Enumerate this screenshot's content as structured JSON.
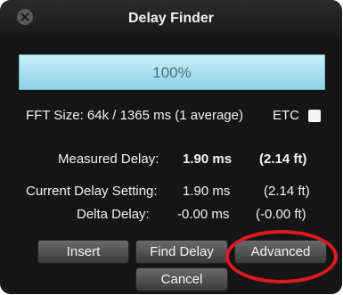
{
  "window": {
    "title": "Delay Finder"
  },
  "progress": {
    "value": 1.0,
    "label": "100%"
  },
  "fft": {
    "label": "FFT Size: 64k / 1365 ms (1 average)"
  },
  "etc": {
    "label": "ETC",
    "checked": false
  },
  "measured": {
    "label": "Measured Delay:",
    "ms": "1.90 ms",
    "ft": "(2.14 ft)"
  },
  "current": {
    "label": "Current Delay Setting:",
    "ms": "1.90 ms",
    "ft": "(2.14 ft)"
  },
  "delta": {
    "label": "Delta Delay:",
    "ms": "-0.00 ms",
    "ft": "(-0.00 ft)"
  },
  "buttons": {
    "insert": "Insert",
    "find_delay": "Find Delay",
    "advanced": "Advanced",
    "cancel": "Cancel"
  },
  "colors": {
    "progress_fill": "#98d6ea",
    "annotation": "#e0191e",
    "window_bg": "#151515"
  }
}
